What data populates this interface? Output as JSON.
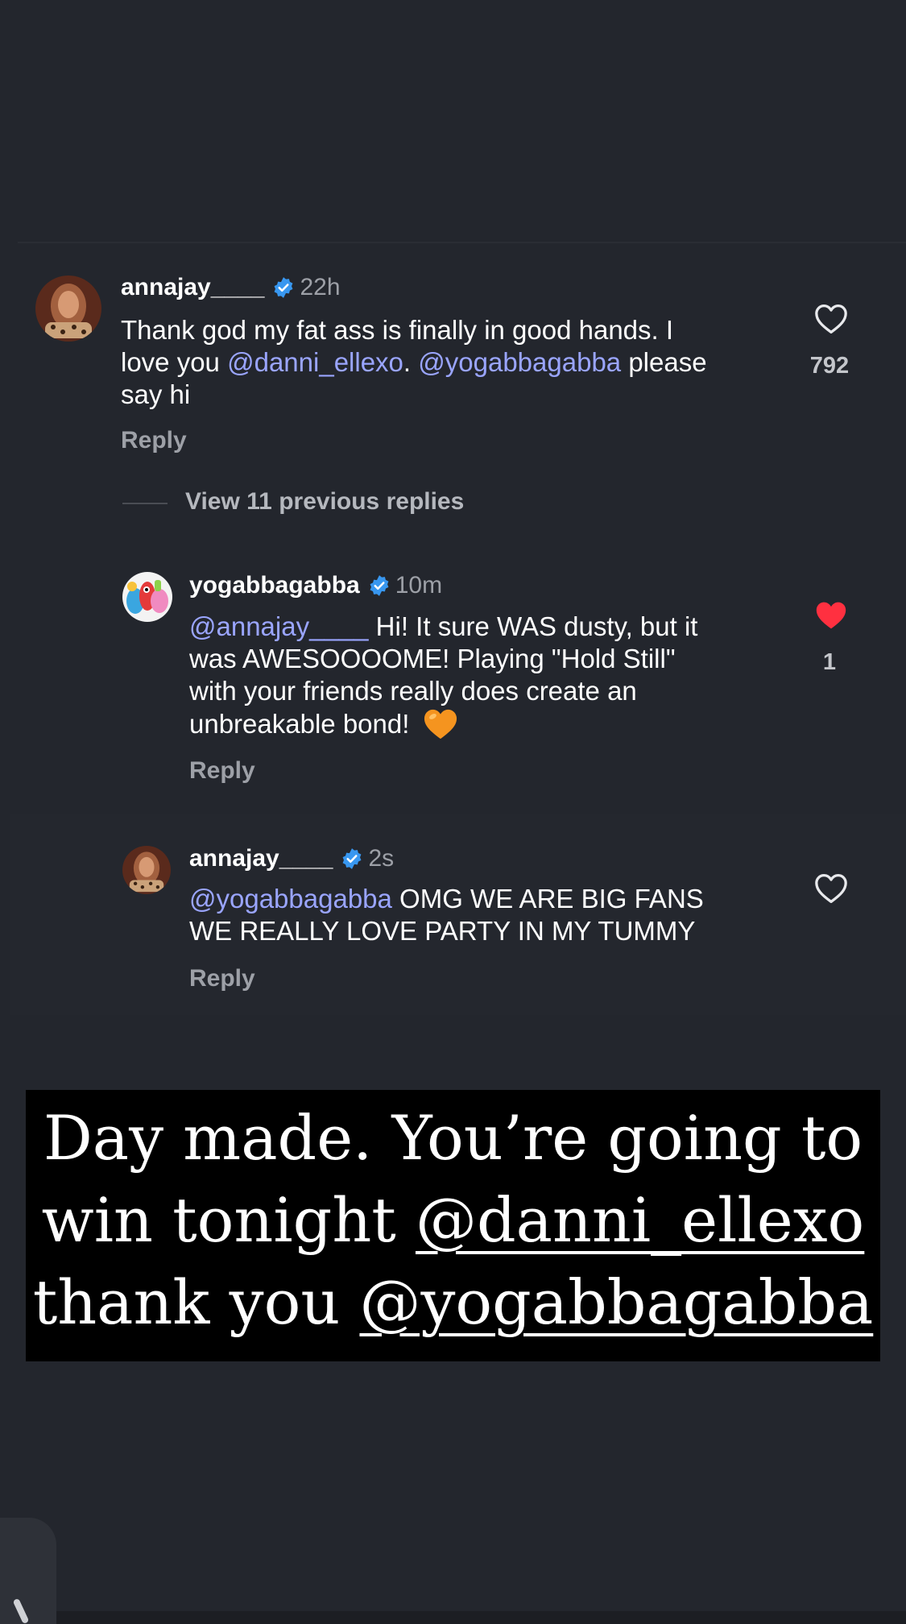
{
  "colors": {
    "background": "#23262d",
    "mention": "#9aa5ff",
    "verified": "#3897f0",
    "liked_heart": "#ff3040",
    "muted": "#9da0a7"
  },
  "comment1": {
    "username": "annajay____",
    "time": "22h",
    "text_a": "Thank god my fat ass is finally in good hands. I",
    "text_b_pre": "love you ",
    "mention1": "@danni_ellexo",
    "text_b_mid": ". ",
    "mention2": "@yogabbagabba",
    "text_b_post": " please",
    "text_c": "say hi",
    "reply_label": "Reply",
    "likes": "792",
    "liked": false
  },
  "view_replies_label": "View 11 previous replies",
  "reply1": {
    "username": "yogabbagabba",
    "time": "10m",
    "mention": "@annajay____",
    "text_a_post": " Hi! It sure WAS dusty, but it",
    "text_b": "was AWESOOOOME! Playing \"Hold Still\"",
    "text_c": "with your friends really does create an",
    "text_d": "unbreakable bond! ",
    "emoji": "orange-heart",
    "reply_label": "Reply",
    "likes": "1",
    "liked": true
  },
  "reply2": {
    "username": "annajay____",
    "time": "2s",
    "mention": "@yogabbagabba",
    "text_a_post": " OMG WE ARE BIG FANS",
    "text_b": "WE REALLY LOVE PARTY IN MY TUMMY",
    "reply_label": "Reply",
    "liked": false
  },
  "caption": {
    "line1": "Day made. You’re going to",
    "line2_pre": "win tonight ",
    "line2_mention": "@danni_ellexo",
    "line3_pre": "thank you ",
    "line3_mention": "@yogabbagabba"
  }
}
